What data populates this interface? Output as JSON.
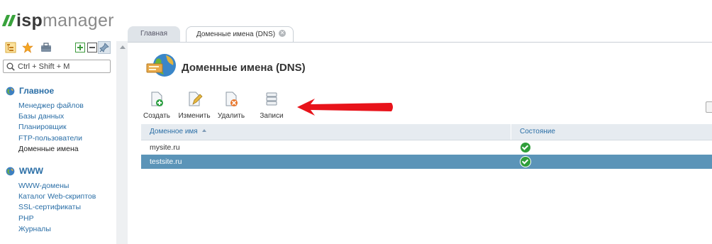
{
  "brand": {
    "logo_bold": "isp",
    "logo_light": "manager"
  },
  "sidebar": {
    "search": {
      "placeholder": "Ctrl + Shift + M"
    },
    "sections": [
      {
        "title": "Главное",
        "items": [
          "Менеджер файлов",
          "Базы данных",
          "Планировщик",
          "FTP-пользователи",
          "Доменные имена"
        ],
        "active_item": "Доменные имена"
      },
      {
        "title": "WWW",
        "items": [
          "WWW-домены",
          "Каталог Web-скриптов",
          "SSL-сертификаты",
          "PHP",
          "Журналы"
        ]
      }
    ]
  },
  "tabs": [
    {
      "label": "Главная",
      "active": false
    },
    {
      "label": "Доменные имена (DNS)",
      "active": true,
      "closable": true
    }
  ],
  "page": {
    "title": "Доменные имена (DNS)"
  },
  "toolbar": {
    "create": "Создать",
    "edit": "Изменить",
    "delete": "Удалить",
    "records": "Записи"
  },
  "table": {
    "columns": [
      "Доменное имя",
      "Состояние"
    ],
    "sort_column": "Доменное имя",
    "sort_direction": "asc",
    "rows": [
      {
        "domain": "mysite.ru",
        "status": "ok",
        "selected": false
      },
      {
        "domain": "testsite.ru",
        "status": "ok",
        "selected": true
      }
    ]
  },
  "colors": {
    "accent": "#2a6ea6",
    "selected_row": "#5b94b8",
    "status_ok": "#2f9e3a",
    "arrow": "#e8131a"
  }
}
